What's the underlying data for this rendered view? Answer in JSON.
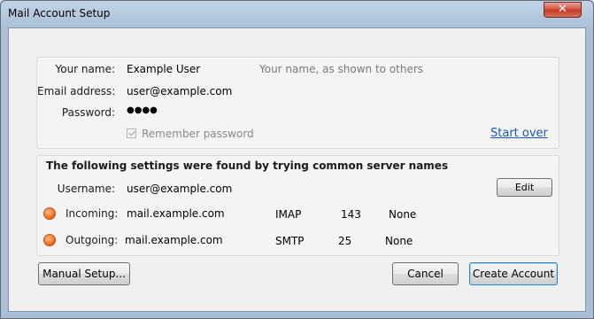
{
  "window": {
    "title": "Mail Account Setup",
    "close_glyph": "✕"
  },
  "account": {
    "name_label": "Your name:",
    "name_value": "Example User",
    "name_hint": "Your name, as shown to others",
    "email_label": "Email address:",
    "email_value": "user@example.com",
    "password_label": "Password:",
    "password_value": "●●●●",
    "remember_label": "Remember password",
    "remember_checked": true,
    "start_over_label": "Start over"
  },
  "settings": {
    "heading": "The following settings were found by trying common server names",
    "username_label": "Username:",
    "username_value": "user@example.com",
    "edit_label": "Edit",
    "incoming": {
      "label": "Incoming:",
      "host": "mail.example.com",
      "protocol": "IMAP",
      "port": "143",
      "security": "None",
      "status_color": "#ff7a1f"
    },
    "outgoing": {
      "label": "Outgoing:",
      "host": "mail.example.com",
      "protocol": "SMTP",
      "port": "25",
      "security": "None",
      "status_color": "#ff7a1f"
    }
  },
  "buttons": {
    "manual_setup": "Manual Setup...",
    "cancel": "Cancel",
    "create_account": "Create Account"
  }
}
